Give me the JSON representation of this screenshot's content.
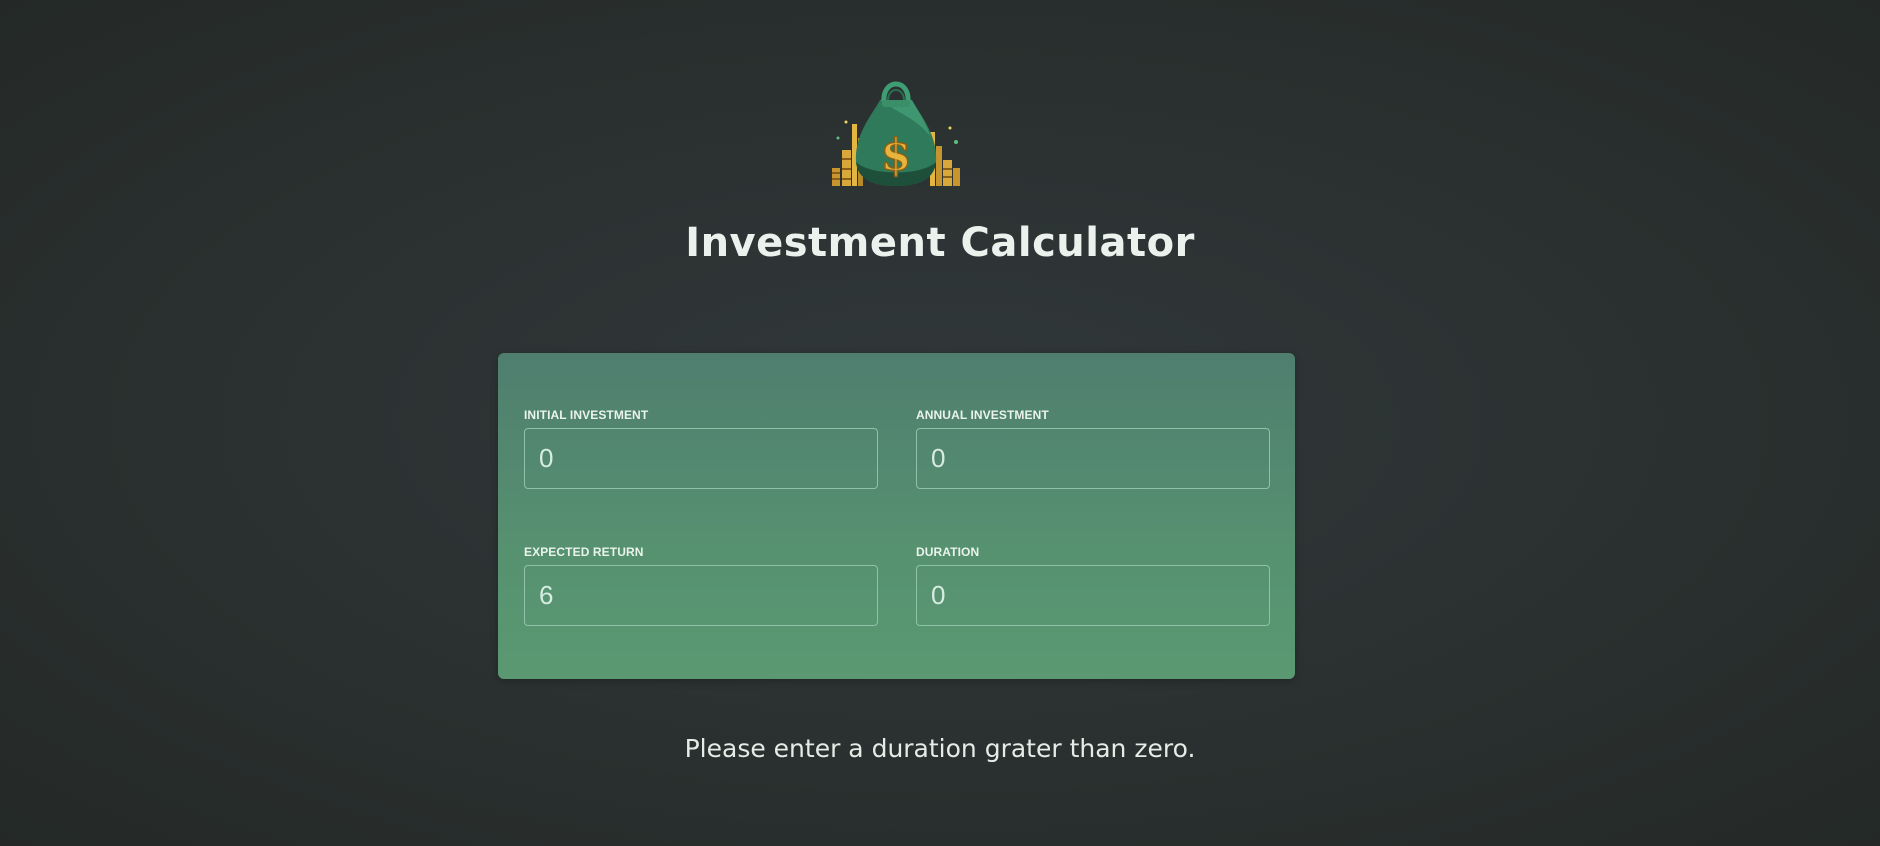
{
  "header": {
    "logo_icon": "money-bag-icon",
    "title": "Investment Calculator"
  },
  "form": {
    "initial_investment": {
      "label": "INITIAL INVESTMENT",
      "value": "0"
    },
    "annual_investment": {
      "label": "ANNUAL INVESTMENT",
      "value": "0"
    },
    "expected_return": {
      "label": "EXPECTED RETURN",
      "value": "6"
    },
    "duration": {
      "label": "DURATION",
      "value": "0"
    }
  },
  "message": "Please enter a duration grater than zero.",
  "colors": {
    "background": "#2c3232",
    "panel_top": "#4f7e6f",
    "panel_bottom": "#5a9972",
    "input_border": "#8ec2a9",
    "coin_gold": "#d9a83a"
  }
}
